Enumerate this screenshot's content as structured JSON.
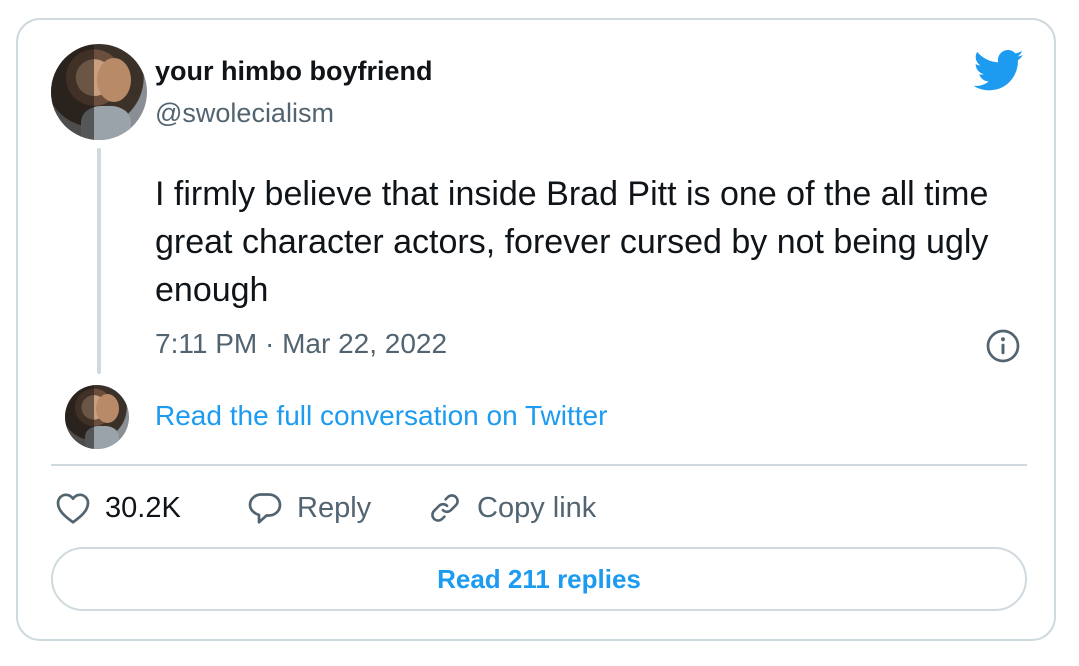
{
  "author": {
    "display_name": "your himbo boyfriend",
    "handle": "@swolecialism"
  },
  "tweet": {
    "text": "I firmly believe that inside Brad Pitt is one of the all time great character actors, forever cursed by not being ugly enough",
    "timestamp": "7:11 PM · Mar 22, 2022"
  },
  "conversation_link": "Read the full conversation on Twitter",
  "actions": {
    "like_count": "30.2K",
    "reply_label": "Reply",
    "copy_link_label": "Copy link"
  },
  "read_replies_label": "Read 211 replies",
  "icons": {
    "logo": "twitter-bird-icon",
    "info": "info-icon",
    "like": "heart-icon",
    "reply": "speech-bubble-icon",
    "copy": "link-icon"
  },
  "colors": {
    "accent": "#1d9bf0",
    "text": "#0f1419",
    "secondary": "#536471",
    "border": "#cfd9de"
  }
}
